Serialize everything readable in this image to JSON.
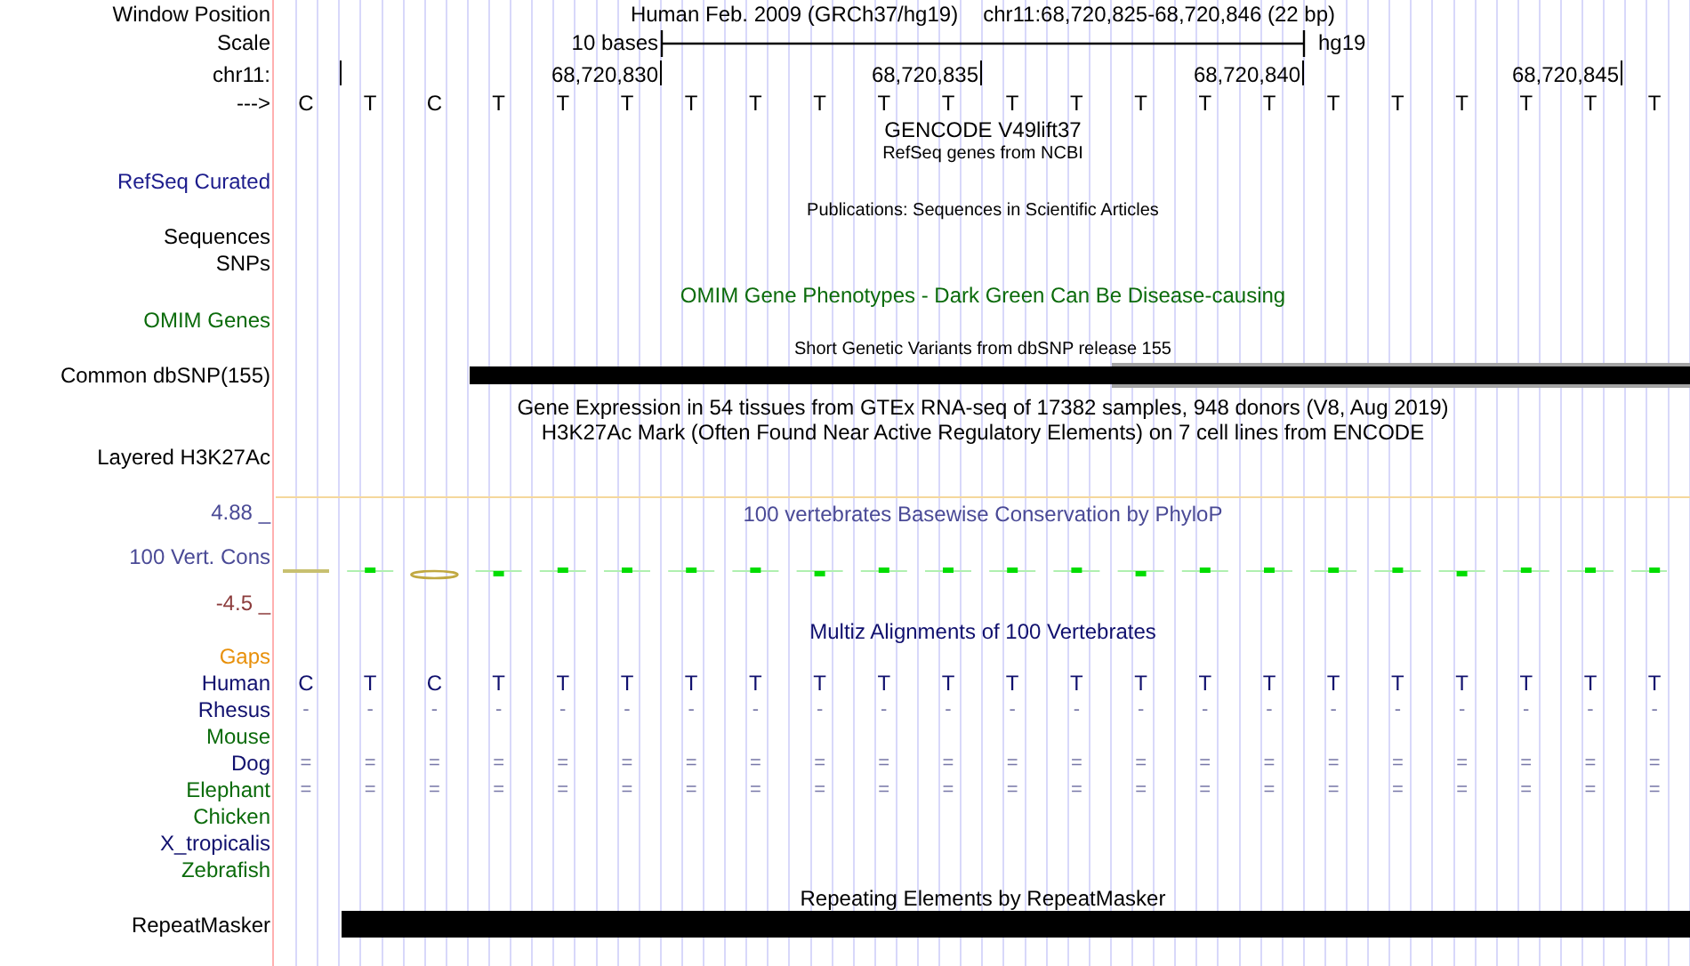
{
  "header": {
    "assembly": "Human Feb. 2009 (GRCh37/hg19)",
    "position": "chr11:68,720,825-68,720,846 (22 bp)"
  },
  "scale": {
    "label": "10 bases",
    "assembly": "hg19"
  },
  "ruler": {
    "ticks": [
      "68,720,830",
      "68,720,835",
      "68,720,840",
      "68,720,845"
    ]
  },
  "bases": [
    "C",
    "T",
    "C",
    "T",
    "T",
    "T",
    "T",
    "T",
    "T",
    "T",
    "T",
    "T",
    "T",
    "T",
    "T",
    "T",
    "T",
    "T",
    "T",
    "T",
    "T",
    "T"
  ],
  "track_labels": [
    {
      "text": "Window Position",
      "color": "#000000"
    },
    {
      "text": "Scale",
      "color": "#000000"
    },
    {
      "text": "chr11:",
      "color": "#000000"
    },
    {
      "text": "--->",
      "color": "#000000"
    },
    {
      "text": "RefSeq Curated",
      "color": "#1c1c8c"
    },
    {
      "text": "Sequences",
      "color": "#000000"
    },
    {
      "text": "SNPs",
      "color": "#000000"
    },
    {
      "text": "OMIM Genes",
      "color": "#0b6b0b"
    },
    {
      "text": "Common dbSNP(155)",
      "color": "#000000"
    },
    {
      "text": "Layered H3K27Ac",
      "color": "#000000"
    },
    {
      "text": "4.88 _",
      "color": "#4a4a96"
    },
    {
      "text": "100 Vert. Cons",
      "color": "#4a4a96"
    },
    {
      "text": "-4.5 _",
      "color": "#8c3c3c"
    },
    {
      "text": "Gaps",
      "color": "#e8900a"
    },
    {
      "text": "Human",
      "color": "#10106e",
      "cells": [
        "C",
        "T",
        "C",
        "T",
        "T",
        "T",
        "T",
        "T",
        "T",
        "T",
        "T",
        "T",
        "T",
        "T",
        "T",
        "T",
        "T",
        "T",
        "T",
        "T",
        "T",
        "T"
      ]
    },
    {
      "text": "Rhesus",
      "color": "#10106e",
      "cells": [
        "-",
        "-",
        "-",
        "-",
        "-",
        "-",
        "-",
        "-",
        "-",
        "-",
        "-",
        "-",
        "-",
        "-",
        "-",
        "-",
        "-",
        "-",
        "-",
        "-",
        "-",
        "-"
      ]
    },
    {
      "text": "Mouse",
      "color": "#0b6b0b"
    },
    {
      "text": "Dog",
      "color": "#10106e",
      "cells": [
        "=",
        "=",
        "=",
        "=",
        "=",
        "=",
        "=",
        "=",
        "=",
        "=",
        "=",
        "=",
        "=",
        "=",
        "=",
        "=",
        "=",
        "=",
        "=",
        "=",
        "=",
        "="
      ]
    },
    {
      "text": "Elephant",
      "color": "#0b6b0b",
      "cells": [
        "=",
        "=",
        "=",
        "=",
        "=",
        "=",
        "=",
        "=",
        "=",
        "=",
        "=",
        "=",
        "=",
        "=",
        "=",
        "=",
        "=",
        "=",
        "=",
        "=",
        "=",
        "="
      ]
    },
    {
      "text": "Chicken",
      "color": "#0b6b0b"
    },
    {
      "text": "X_tropicalis",
      "color": "#10106e"
    },
    {
      "text": "Zebrafish",
      "color": "#0b6b0b"
    },
    {
      "text": "RepeatMasker",
      "color": "#000000"
    }
  ],
  "track_titles": [
    {
      "text": "GENCODE V49lift37",
      "kind": "large",
      "color": "#000000"
    },
    {
      "text": "RefSeq genes from NCBI",
      "kind": "small",
      "color": "#000000"
    },
    {
      "text": "Publications: Sequences in Scientific Articles",
      "kind": "small",
      "color": "#000000"
    },
    {
      "text": "OMIM Gene Phenotypes - Dark Green Can Be Disease-causing",
      "kind": "large",
      "color": "#0b6b0b"
    },
    {
      "text": "Short Genetic Variants from dbSNP release 155",
      "kind": "small",
      "color": "#000000"
    },
    {
      "text": "Gene Expression in 54 tissues from GTEx RNA-seq of 17382 samples, 948 donors (V8, Aug 2019)",
      "kind": "large",
      "color": "#000000"
    },
    {
      "text": "H3K27Ac Mark (Often Found Near Active Regulatory Elements) on 7 cell lines from ENCODE",
      "kind": "large",
      "color": "#000000"
    },
    {
      "text": "100 vertebrates Basewise Conservation by PhyloP",
      "kind": "large",
      "color": "#4a4a96"
    },
    {
      "text": "Multiz Alignments of 100 Vertebrates",
      "kind": "large",
      "color": "#10106e"
    },
    {
      "text": "Repeating Elements by RepeatMasker",
      "kind": "large",
      "color": "#000000"
    }
  ]
}
